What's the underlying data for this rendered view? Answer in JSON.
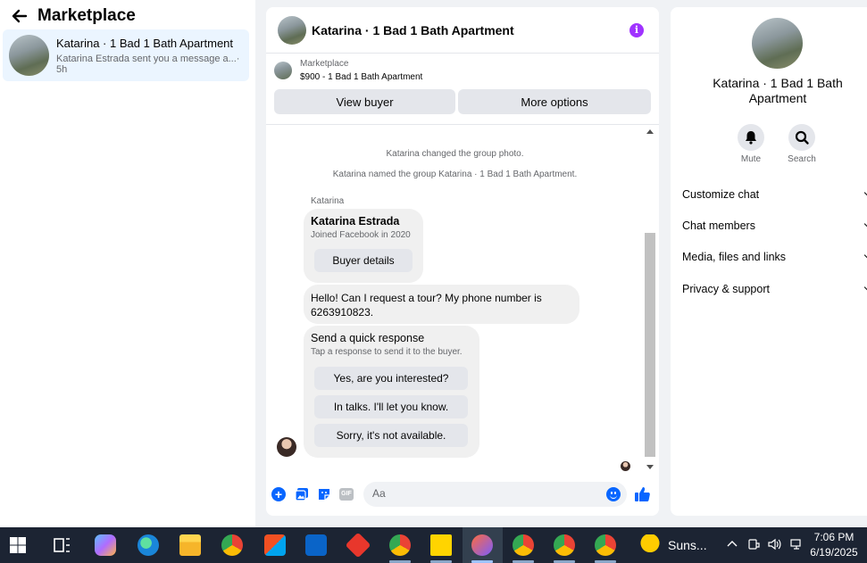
{
  "left_panel": {
    "title": "Marketplace",
    "conversation": {
      "title": "Katarina · 1 Bad 1 Bath Apartment",
      "preview": "Katarina Estrada sent you a message a...",
      "time": "· 5h"
    }
  },
  "chat": {
    "title": "Katarina · 1 Bad 1 Bath Apartment",
    "info_icon": "i",
    "listing": {
      "category": "Marketplace",
      "price_title": "$900 - 1 Bad 1 Bath Apartment",
      "view_buyer_label": "View buyer",
      "more_options_label": "More options"
    },
    "system_messages": [
      "Katarina changed the group photo.",
      "Katarina named the group Katarina · 1 Bad 1 Bath Apartment."
    ],
    "sender_name": "Katarina",
    "buyer_card": {
      "name": "Katarina Estrada",
      "joined": "Joined Facebook in 2020",
      "button": "Buyer details"
    },
    "message": "Hello! Can I request a tour? My phone number is 6263910823.",
    "quick_response": {
      "title": "Send a quick response",
      "subtitle": "Tap a response to send it to the buyer.",
      "options": [
        "Yes, are you interested?",
        "In talks. I'll let you know.",
        "Sorry, it's not available."
      ]
    },
    "composer": {
      "placeholder": "Aa",
      "gif_label": "GIF"
    },
    "accent_color": "#0866ff"
  },
  "right_panel": {
    "title": "Katarina · 1 Bad 1 Bath Apartment",
    "actions": [
      {
        "label": "Mute",
        "icon": "bell-icon"
      },
      {
        "label": "Search",
        "icon": "search-icon"
      }
    ],
    "sections": [
      "Customize chat",
      "Chat members",
      "Media, files and links",
      "Privacy & support"
    ]
  },
  "taskbar": {
    "weather": "Suns...",
    "time": "7:06 PM",
    "date": "6/19/2025"
  }
}
